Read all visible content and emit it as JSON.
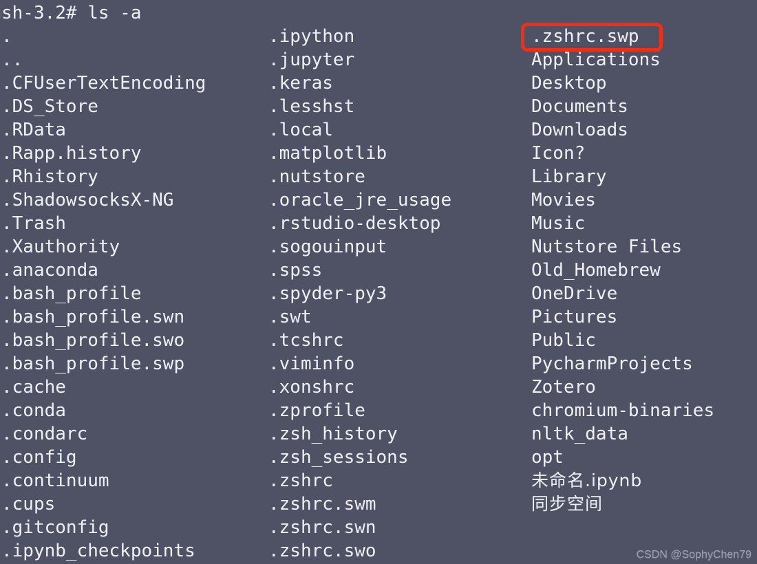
{
  "terminal": {
    "background_color": "#4f5165",
    "text_color": "#eef0f4",
    "prompt": "sh-3.2# ls -a",
    "edge_glyph": "b",
    "columns": [
      {
        "name": "column-1",
        "entries": [
          ".",
          "..",
          ".CFUserTextEncoding",
          ".DS_Store",
          ".RData",
          ".Rapp.history",
          ".Rhistory",
          ".ShadowsocksX-NG",
          ".Trash",
          ".Xauthority",
          ".anaconda",
          ".bash_profile",
          ".bash_profile.swn",
          ".bash_profile.swo",
          ".bash_profile.swp",
          ".cache",
          ".conda",
          ".condarc",
          ".config",
          ".continuum",
          ".cups",
          ".gitconfig",
          ".ipynb_checkpoints"
        ]
      },
      {
        "name": "column-2",
        "entries": [
          ".ipython",
          ".jupyter",
          ".keras",
          ".lesshst",
          ".local",
          ".matplotlib",
          ".nutstore",
          ".oracle_jre_usage",
          ".rstudio-desktop",
          ".sogouinput",
          ".spss",
          ".spyder-py3",
          ".swt",
          ".tcshrc",
          ".viminfo",
          ".xonshrc",
          ".zprofile",
          ".zsh_history",
          ".zsh_sessions",
          ".zshrc",
          ".zshrc.swm",
          ".zshrc.swn",
          ".zshrc.swo"
        ]
      },
      {
        "name": "column-3",
        "entries": [
          ".zshrc.swp",
          "Applications",
          "Desktop",
          "Documents",
          "Downloads",
          "Icon?",
          "Library",
          "Movies",
          "Music",
          "Nutstore Files",
          "Old_Homebrew",
          "OneDrive",
          "Pictures",
          "Public",
          "PycharmProjects",
          "Zotero",
          "chromium-binaries",
          "nltk_data",
          "opt",
          "未命名.ipynb",
          "同步空间"
        ]
      }
    ]
  },
  "annotation": {
    "target_entry": ".zshrc.swp",
    "box_color": "#f22e15"
  },
  "watermark": {
    "text": "CSDN @SophyChen79"
  }
}
